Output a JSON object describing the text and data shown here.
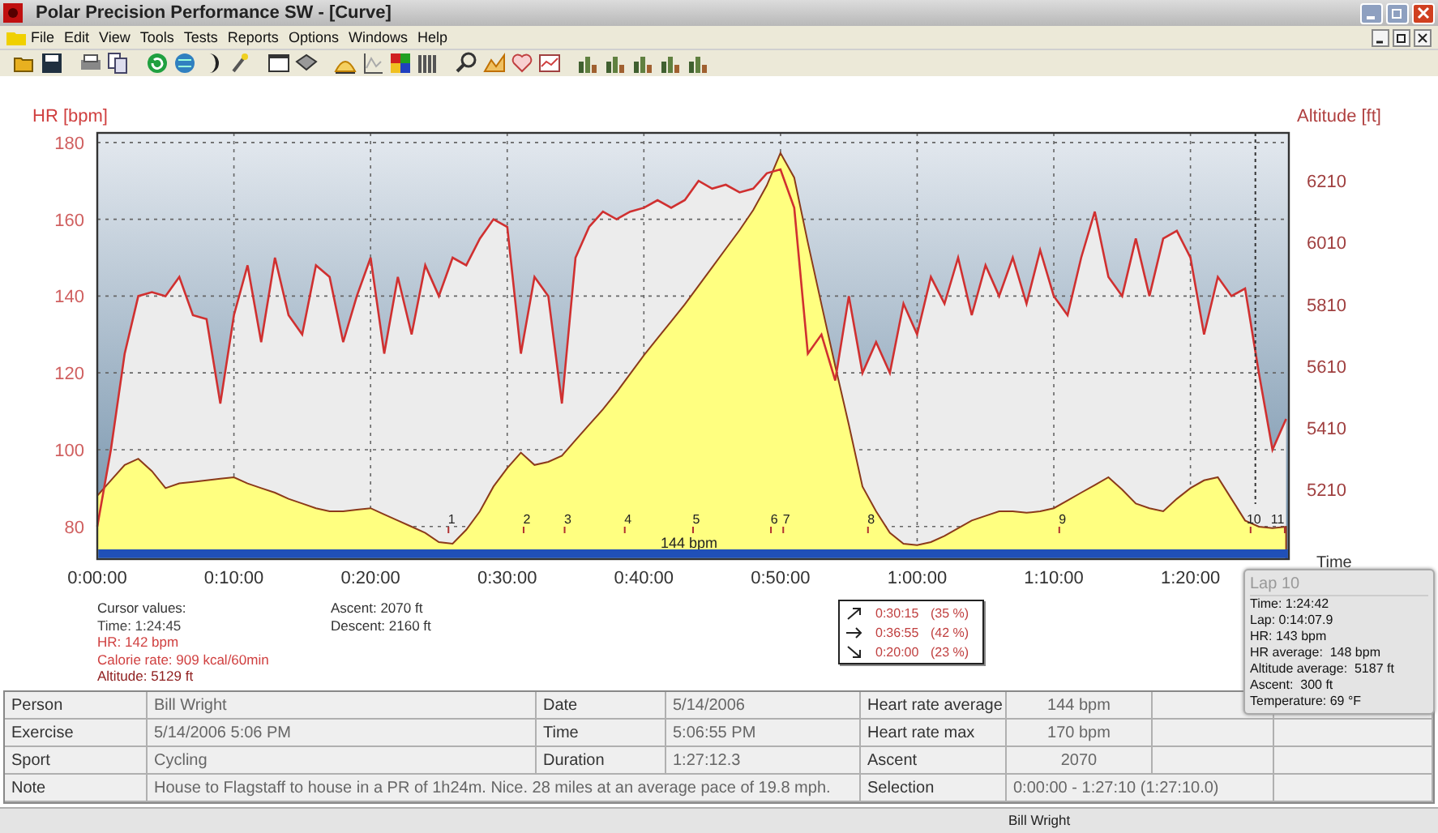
{
  "window": {
    "title": "Polar Precision Performance SW - [Curve]"
  },
  "menu": [
    "File",
    "Edit",
    "View",
    "Tools",
    "Tests",
    "Reports",
    "Options",
    "Windows",
    "Help"
  ],
  "chart": {
    "chart_data": {
      "type": "area",
      "xlabel": "Time",
      "ylabel": "HR [bpm]",
      "y2label": "Altitude [ft]",
      "x": [
        0,
        1,
        2,
        3,
        4,
        5,
        6,
        7,
        8,
        9,
        10,
        11,
        12,
        13,
        14,
        15,
        16,
        17,
        18,
        19,
        20,
        21,
        22,
        23,
        24,
        25,
        26,
        27,
        28,
        29,
        30,
        31,
        32,
        33,
        34,
        35,
        36,
        37,
        38,
        39,
        40,
        41,
        42,
        43,
        44,
        45,
        46,
        47,
        48,
        49,
        50,
        51,
        52,
        53,
        54,
        55,
        56,
        57,
        58,
        59,
        60,
        61,
        62,
        63,
        64,
        65,
        66,
        67,
        68,
        69,
        70,
        71,
        72,
        73,
        74,
        75,
        76,
        77,
        78,
        79,
        80,
        81,
        82,
        83,
        84,
        85,
        86,
        87
      ],
      "series": [
        {
          "color": "#d03030",
          "values": [
            80,
            100,
            125,
            140,
            141,
            140,
            145,
            135,
            134,
            112,
            135,
            148,
            128,
            150,
            135,
            130,
            148,
            145,
            128,
            140,
            150,
            125,
            145,
            130,
            148,
            140,
            150,
            148,
            155,
            160,
            158,
            125,
            145,
            140,
            112,
            150,
            158,
            162,
            160,
            162,
            163,
            165,
            163,
            165,
            170,
            168,
            169,
            167,
            168,
            172,
            173,
            163,
            125,
            130,
            118,
            140,
            120,
            128,
            120,
            138,
            130,
            145,
            138,
            150,
            135,
            148,
            140,
            150,
            138,
            152,
            140,
            135,
            150,
            162,
            145,
            140,
            155,
            140,
            155,
            157,
            150,
            130,
            145,
            140,
            142,
            120,
            100,
            108
          ]
        },
        {
          "color": "#8b3a1a",
          "axis": "y2",
          "values": [
            5190,
            5240,
            5290,
            5310,
            5270,
            5215,
            5230,
            5235,
            5240,
            5245,
            5250,
            5230,
            5215,
            5200,
            5180,
            5165,
            5150,
            5140,
            5140,
            5145,
            5150,
            5130,
            5110,
            5090,
            5070,
            5040,
            5035,
            5080,
            5140,
            5220,
            5280,
            5330,
            5290,
            5300,
            5320,
            5370,
            5420,
            5470,
            5525,
            5585,
            5645,
            5700,
            5755,
            5810,
            5870,
            5930,
            5990,
            6050,
            6115,
            6195,
            6300,
            6220,
            6010,
            5810,
            5610,
            5420,
            5220,
            5140,
            5070,
            5035,
            5030,
            5040,
            5060,
            5085,
            5110,
            5125,
            5140,
            5140,
            5135,
            5140,
            5150,
            5175,
            5200,
            5225,
            5250,
            5210,
            5165,
            5150,
            5140,
            5180,
            5215,
            5240,
            5250,
            5180,
            5110,
            5090,
            5085,
            5090
          ]
        }
      ],
      "xlim": [
        0,
        87.2
      ],
      "ylim": [
        71.5,
        182.5
      ],
      "y2lim": [
        4985,
        6365
      ],
      "xticks": [
        {
          "value": 0,
          "label": "0:00:00"
        },
        {
          "value": 10,
          "label": "0:10:00"
        },
        {
          "value": 20,
          "label": "0:20:00"
        },
        {
          "value": 30,
          "label": "0:30:00"
        },
        {
          "value": 40,
          "label": "0:40:00"
        },
        {
          "value": 50,
          "label": "0:50:00"
        },
        {
          "value": 60,
          "label": "1:00:00"
        },
        {
          "value": 70,
          "label": "1:10:00"
        },
        {
          "value": 80,
          "label": "1:20:00"
        }
      ],
      "yticks": [
        80,
        100,
        120,
        140,
        160,
        180
      ],
      "y2ticks": [
        5210,
        5410,
        5610,
        5810,
        6010,
        6210
      ],
      "grid": true,
      "ref_lines": [
        {
          "axis": "x",
          "value": 84.75
        }
      ]
    },
    "laps": [
      "1",
      "2",
      "3",
      "4",
      "5",
      "6",
      "7",
      "8",
      "9",
      "10",
      "11"
    ],
    "average_label": "144 bpm"
  },
  "cursor_values": {
    "heading": "Cursor values:",
    "lines": [
      {
        "text": "Time: 1:24:45",
        "color": "#404040"
      },
      {
        "text": "HR: 142 bpm",
        "color": "#d04040"
      },
      {
        "text": "Calorie rate: 909 kcal/60min",
        "color": "#d04040"
      },
      {
        "text": "Altitude: 5129 ft",
        "color": "#902020"
      }
    ]
  },
  "ascent_descent": [
    "Ascent: 2070 ft",
    "Descent: 2160 ft"
  ],
  "slope_summary": [
    {
      "kind": "up",
      "time": "0:30:15",
      "share": "(35 %)"
    },
    {
      "kind": "flat",
      "time": "0:36:55",
      "share": "(42 %)"
    },
    {
      "kind": "down",
      "time": "0:20:00",
      "share": "(23 %)"
    }
  ],
  "lap_tooltip": {
    "title": "Lap 10",
    "lines": [
      "Time: 1:24:42",
      "Lap: 0:14:07.9",
      "HR: 143 bpm",
      "HR average:  148 bpm",
      "Altitude average:  5187 ft",
      "Ascent:  300 ft",
      "Temperature: 69 °F"
    ]
  },
  "table": {
    "rows": [
      [
        {
          "kind": "label",
          "text": "Person"
        },
        {
          "kind": "value",
          "text": "Bill Wright"
        },
        {
          "kind": "label",
          "text": "Date"
        },
        {
          "kind": "value",
          "text": "5/14/2006"
        },
        {
          "kind": "label",
          "text": "Heart rate average"
        },
        {
          "kind": "number",
          "text": "144 bpm"
        }
      ],
      [
        {
          "kind": "label",
          "text": "Exercise"
        },
        {
          "kind": "value",
          "text": "5/14/2006 5:06 PM"
        },
        {
          "kind": "label",
          "text": "Time"
        },
        {
          "kind": "value",
          "text": "5:06:55 PM"
        },
        {
          "kind": "label",
          "text": "Heart rate max"
        },
        {
          "kind": "number",
          "text": "170 bpm"
        }
      ],
      [
        {
          "kind": "label",
          "text": "Sport"
        },
        {
          "kind": "value",
          "text": "Cycling"
        },
        {
          "kind": "label",
          "text": "Duration"
        },
        {
          "kind": "value",
          "text": "1:27:12.3"
        },
        {
          "kind": "label",
          "text": "Ascent"
        },
        {
          "kind": "number",
          "text": "2070"
        }
      ],
      [
        {
          "kind": "label",
          "text": "Note"
        },
        {
          "kind": "value",
          "text": "House to Flagstaff to house in a PR of 1h24m. Nice. 28 miles at an average pace of 19.8 mph."
        },
        {
          "kind": "merged"
        },
        {
          "kind": "merged"
        },
        {
          "kind": "label",
          "text": "Selection"
        },
        {
          "kind": "value",
          "text": "0:00:00 - 1:27:10 (1:27:10.0)"
        },
        {
          "kind": "merged"
        }
      ]
    ]
  },
  "status_bar": {
    "user": "Bill Wright"
  }
}
